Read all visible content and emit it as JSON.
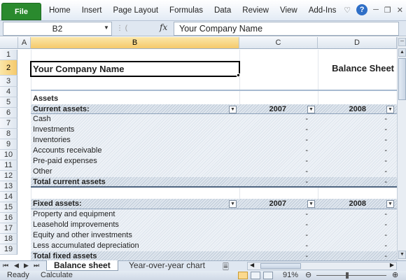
{
  "ribbon": {
    "file_tab": "File",
    "tabs": [
      "Home",
      "Insert",
      "Page Layout",
      "Formulas",
      "Data",
      "Review",
      "View",
      "Add-Ins"
    ],
    "icons": [
      "heart-icon",
      "help-icon",
      "minimize-icon",
      "restore-icon",
      "close-icon"
    ],
    "help_glyph": "?"
  },
  "formula_bar": {
    "name_box": "B2",
    "fx_label": "fx",
    "content": "Your Company Name"
  },
  "columns": [
    "A",
    "B",
    "C",
    "D"
  ],
  "rows": [
    "1",
    "2",
    "3",
    "4",
    "5",
    "6",
    "7",
    "8",
    "9",
    "10",
    "11",
    "12",
    "13",
    "14",
    "15",
    "16",
    "17",
    "18",
    "19"
  ],
  "sheet": {
    "company_name": "Your Company Name",
    "report_title": "Balance Sheet",
    "assets_heading": "Assets",
    "current_assets_header": "Current assets:",
    "fixed_assets_header": "Fixed assets:",
    "year_1": "2007",
    "year_2": "2008",
    "current_assets_items": [
      "Cash",
      "Investments",
      "Inventories",
      "Accounts receivable",
      "Pre-paid expenses",
      "Other"
    ],
    "total_current_assets": "Total current assets",
    "fixed_assets_items": [
      "Property and equipment",
      "Leasehold improvements",
      "Equity and other investments",
      "Less accumulated depreciation"
    ],
    "total_fixed_assets": "Total fixed assets",
    "empty_value": "-"
  },
  "sheet_tabs": [
    "Balance sheet",
    "Year-over-year chart"
  ],
  "status": {
    "ready": "Ready",
    "calculate": "Calculate",
    "zoom": "91%"
  },
  "colors": {
    "file_tab": "#2a8a2e",
    "selection_header": "#f5c96b",
    "header_hatch": "#bfcbd8"
  }
}
